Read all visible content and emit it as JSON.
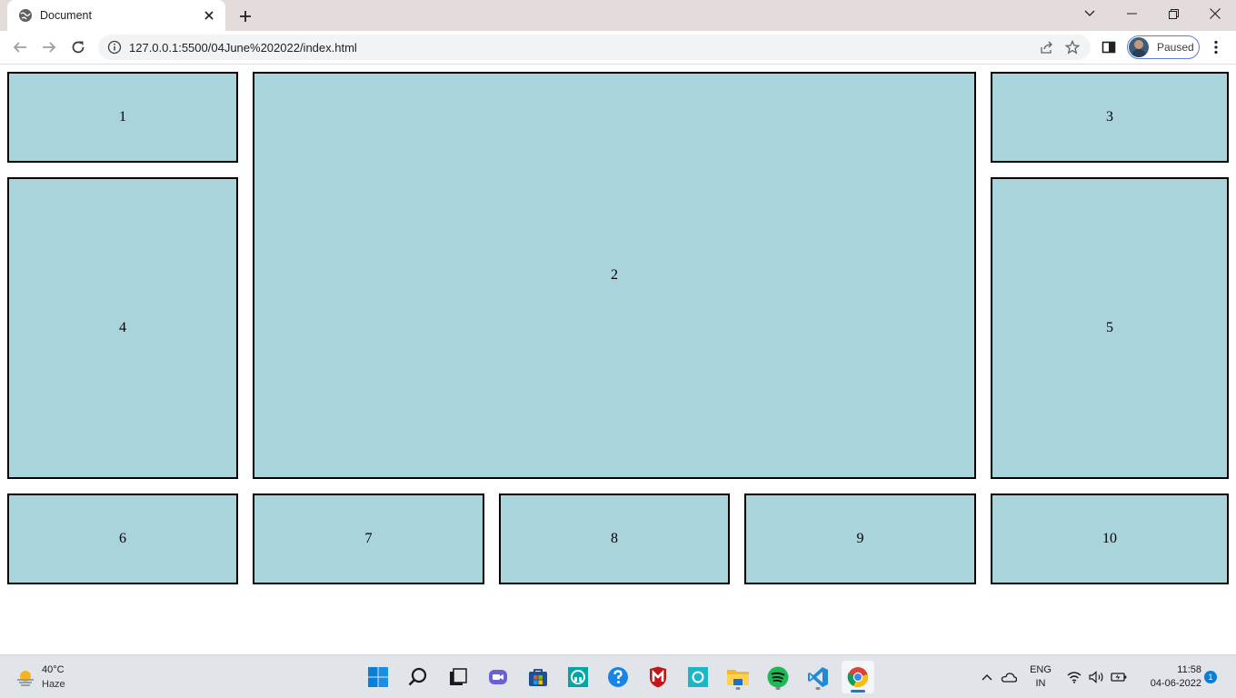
{
  "browser": {
    "tab_title": "Document",
    "url": "127.0.0.1:5500/04June%202022/index.html",
    "profile_label": "Paused"
  },
  "page": {
    "boxes": [
      "1",
      "2",
      "3",
      "4",
      "5",
      "6",
      "7",
      "8",
      "9",
      "10"
    ],
    "box_color": "#aad4dc",
    "border_color": "#000000"
  },
  "taskbar": {
    "weather_temp": "40°C",
    "weather_condition": "Haze",
    "language": "ENG",
    "region": "IN",
    "time": "11:58",
    "date": "04-06-2022",
    "notification_count": "1"
  }
}
